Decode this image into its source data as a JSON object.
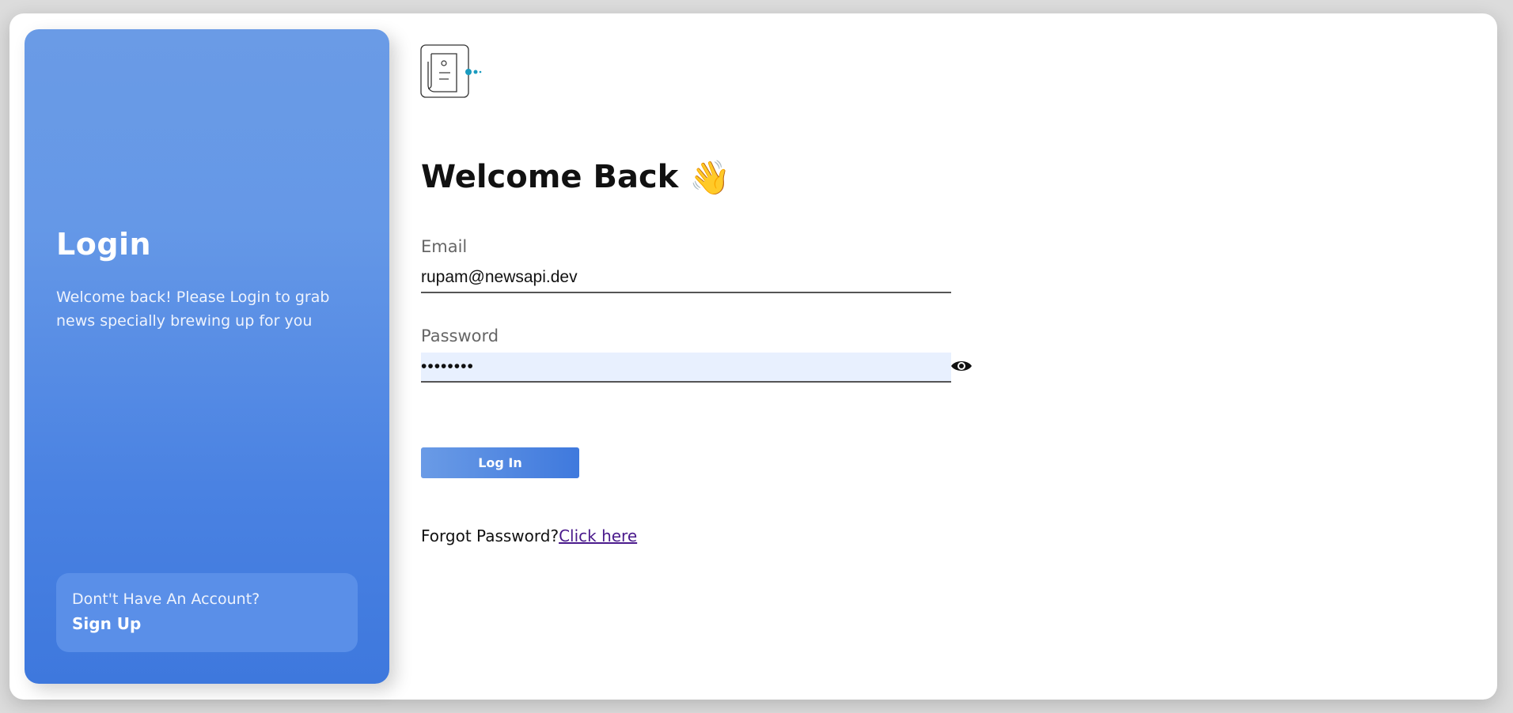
{
  "sidebar": {
    "title": "Login",
    "subtitle": "Welcome back! Please Login to grab news specially brewing up for you",
    "signup_prompt": "Dont't Have An Account?",
    "signup_link": "Sign Up"
  },
  "logo": {
    "icon": "newspaper-api-logo-icon"
  },
  "main": {
    "heading": "Welcome Back",
    "heading_emoji": "👋",
    "email_label": "Email",
    "email_value": "rupam@newsapi.dev",
    "password_label": "Password",
    "password_value": "password",
    "login_button": "Log In",
    "forgot_text": "Forgot Password?",
    "forgot_link": "Click here"
  },
  "colors": {
    "accent": "#4a82e2",
    "autofill": "#e8f0fe",
    "link_visited": "#4a1a8c"
  }
}
